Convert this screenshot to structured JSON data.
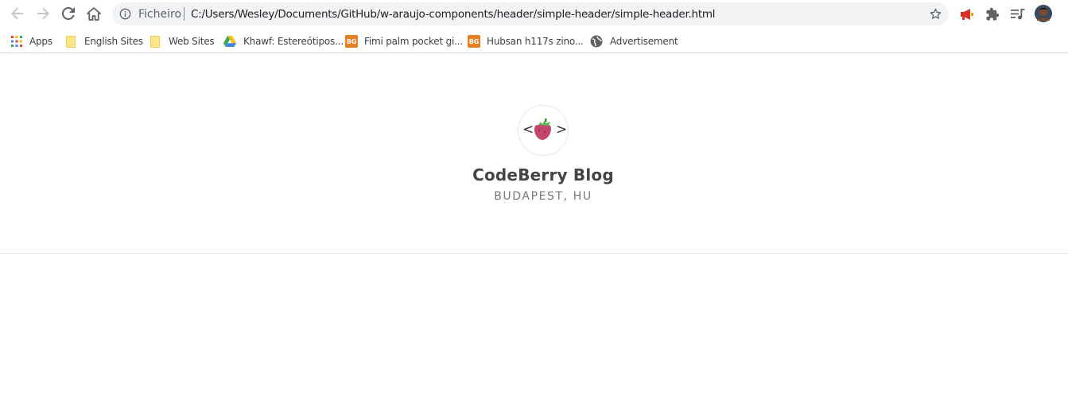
{
  "browser": {
    "omnibox": {
      "scheme_label": "Ficheiro",
      "url": "C:/Users/Wesley/Documents/GitHub/w-araujo-components/header/simple-header/simple-header.html"
    },
    "nav_icons": [
      "back-arrow-icon",
      "forward-arrow-icon",
      "reload-icon",
      "home-icon"
    ],
    "extension_icons": [
      "megaphone-icon",
      "puzzle-icon",
      "media-queue-icon",
      "profile-avatar"
    ]
  },
  "bookmarks": {
    "items": [
      {
        "label": "Apps",
        "icon": "apps-grid-icon"
      },
      {
        "label": "English Sites",
        "icon": "folder-icon"
      },
      {
        "label": "Web Sites",
        "icon": "folder-icon"
      },
      {
        "label": "Khawf: Estereótipos...",
        "icon": "google-drive-icon"
      },
      {
        "label": "Fimi palm pocket gi...",
        "icon": "bg-badge-icon",
        "badge": "BG"
      },
      {
        "label": "Hubsan h117s zino...",
        "icon": "bg-badge-icon",
        "badge": "BG"
      },
      {
        "label": "Advertisement",
        "icon": "globe-icon"
      }
    ]
  },
  "header": {
    "logo_left": "<",
    "logo_right": ">",
    "title": "CodeBerry Blog",
    "location": "BUDAPEST, HU"
  },
  "colors": {
    "accent_berry": "#c2476b",
    "leaf_green": "#5cb85c",
    "badge_orange": "#e67e22"
  }
}
